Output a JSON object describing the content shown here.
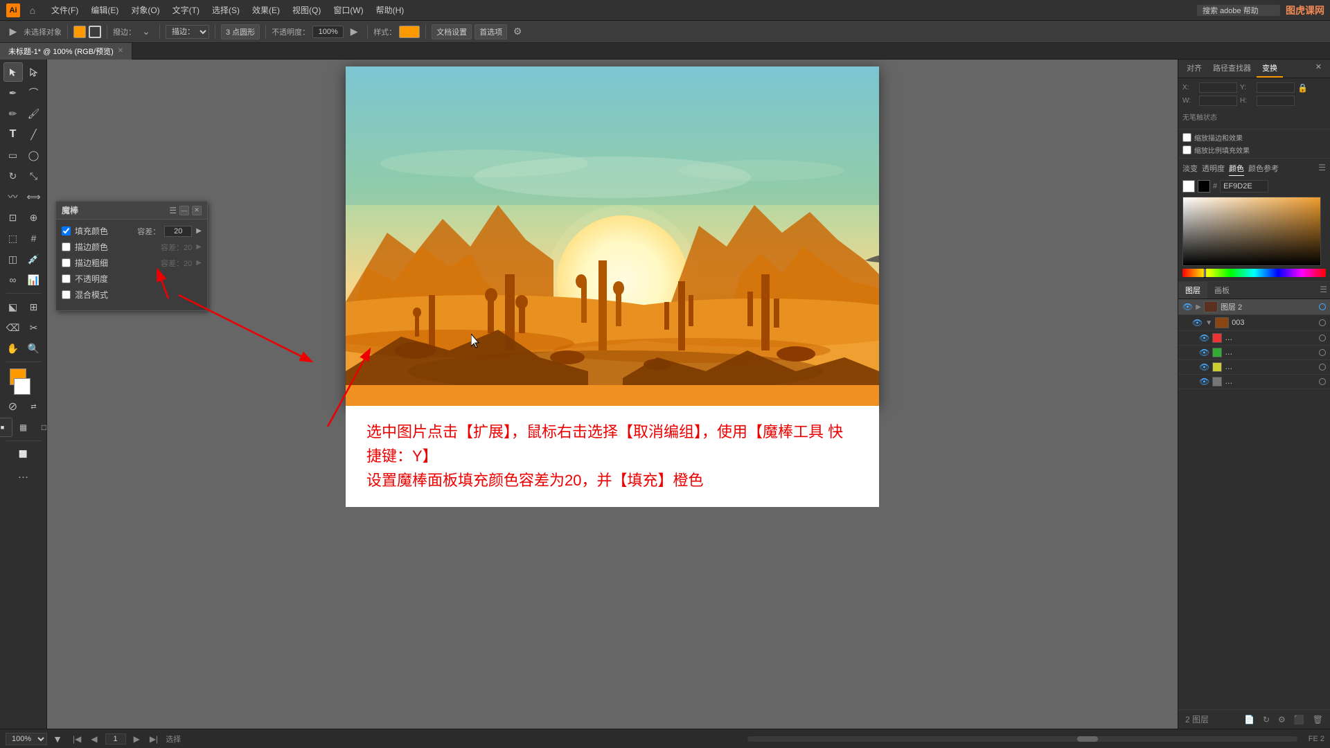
{
  "app": {
    "title": "Adobe Illustrator",
    "logo": "Ai",
    "logo_color": "#FF7F00"
  },
  "menu": {
    "items": [
      "文件(F)",
      "编辑(E)",
      "对象(O)",
      "文字(T)",
      "选择(S)",
      "效果(E)",
      "视图(Q)",
      "窗口(W)",
      "帮助(H)"
    ]
  },
  "toolbar": {
    "stroke_label": "描边：",
    "brush_label": "撥边：",
    "point_label": "3 点圆形",
    "opacity_label": "不透明度：",
    "opacity_value": "100%",
    "style_label": "样式：",
    "doc_settings": "文档设置",
    "first_option": "首选项"
  },
  "tab": {
    "name": "未标题-1* @ 100% (RGB/预览)"
  },
  "canvas": {
    "zoom": "100%",
    "page": "1",
    "status": "选择"
  },
  "magic_wand": {
    "title": "魔棒",
    "fill_color": "填充颜色",
    "stroke_color": "描边颜色",
    "stroke_width": "描边粗细",
    "opacity": "不透明度",
    "blend_mode": "混合模式",
    "tolerance_label": "容差：",
    "tolerance_value": "20"
  },
  "right_panel": {
    "tabs": [
      "对齐",
      "路径查找器",
      "变换"
    ],
    "active_tab": "变换",
    "transform": {
      "x_label": "X:",
      "y_label": "Y:",
      "w_label": "W:",
      "h_label": "H:"
    },
    "no_status": "无笔触状态",
    "color": {
      "hex": "EF9D2E",
      "hash": "#"
    },
    "color_tabs": [
      "淡变",
      "透明度",
      "颜色",
      "颜色参考"
    ],
    "active_color_tab": "颜色"
  },
  "layers": {
    "tabs": [
      "图层",
      "画板"
    ],
    "active_tab": "图层",
    "items": [
      {
        "name": "图层 2",
        "visible": true,
        "expanded": true,
        "active": true
      },
      {
        "name": "003",
        "visible": true,
        "expanded": false
      },
      {
        "name": "...",
        "visible": true,
        "color": "red"
      },
      {
        "name": "...",
        "visible": true,
        "color": "green"
      },
      {
        "name": "...",
        "visible": true,
        "color": "yellow"
      },
      {
        "name": "...",
        "visible": true,
        "color": "gray"
      }
    ],
    "bottom_label": "2 图层"
  },
  "instruction": {
    "line1": "选中图片点击【扩展】，鼠标右击选择【取消编组】，使用【魔棒工具 快捷键：Y】",
    "line2": "设置魔棒面板填充颜色容差为20，并【填充】橙色"
  },
  "watermark": "图虎课网"
}
